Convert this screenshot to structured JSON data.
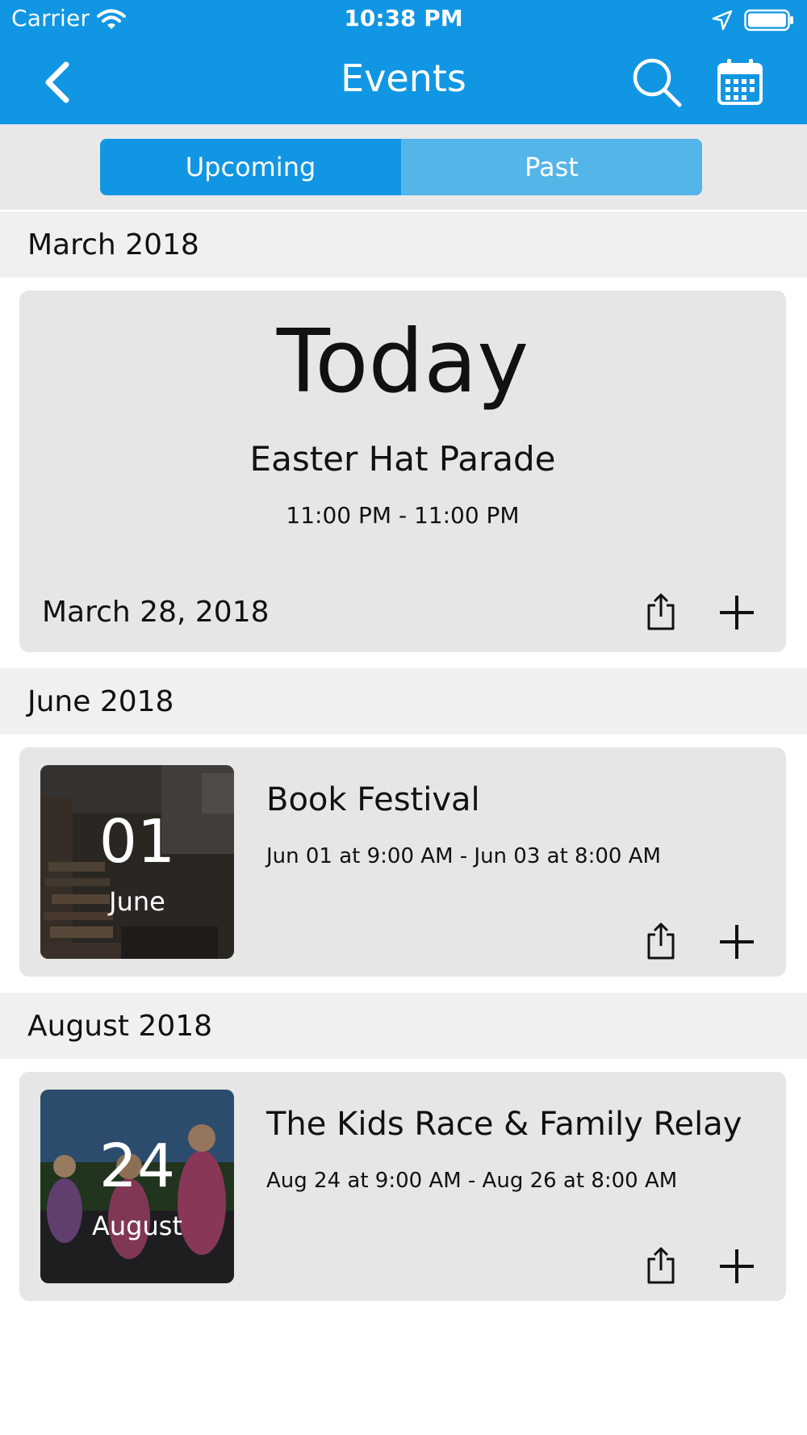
{
  "status_bar": {
    "carrier": "Carrier",
    "time": "10:38 PM"
  },
  "nav": {
    "title": "Events"
  },
  "tabs": {
    "upcoming": "Upcoming",
    "past": "Past",
    "selected": "Upcoming"
  },
  "sections": [
    {
      "month": "March 2018",
      "featured": {
        "label": "Today",
        "name": "Easter Hat Parade",
        "time": "11:00 PM - 11:00 PM",
        "date": "March 28, 2018"
      }
    },
    {
      "month": "June 2018",
      "event": {
        "day": "01",
        "month_name": "June",
        "title": "Book Festival",
        "time": "Jun 01 at 9:00 AM - Jun 03 at 8:00 AM"
      }
    },
    {
      "month": "August 2018",
      "event": {
        "day": "24",
        "month_name": "August",
        "title": "The Kids Race & Family Relay",
        "time": "Aug 24 at 9:00 AM - Aug 26 at 8:00 AM"
      }
    }
  ],
  "icons": {
    "back": "chevron-left-icon",
    "search": "search-icon",
    "calendar": "calendar-icon",
    "share": "share-icon",
    "add": "plus-icon"
  },
  "colors": {
    "header": "#1196e3",
    "segment_active": "#1196e3",
    "segment_inactive": "#53b5e8",
    "section_bg": "#f0f0f0",
    "card_bg": "#e6e6e6"
  }
}
